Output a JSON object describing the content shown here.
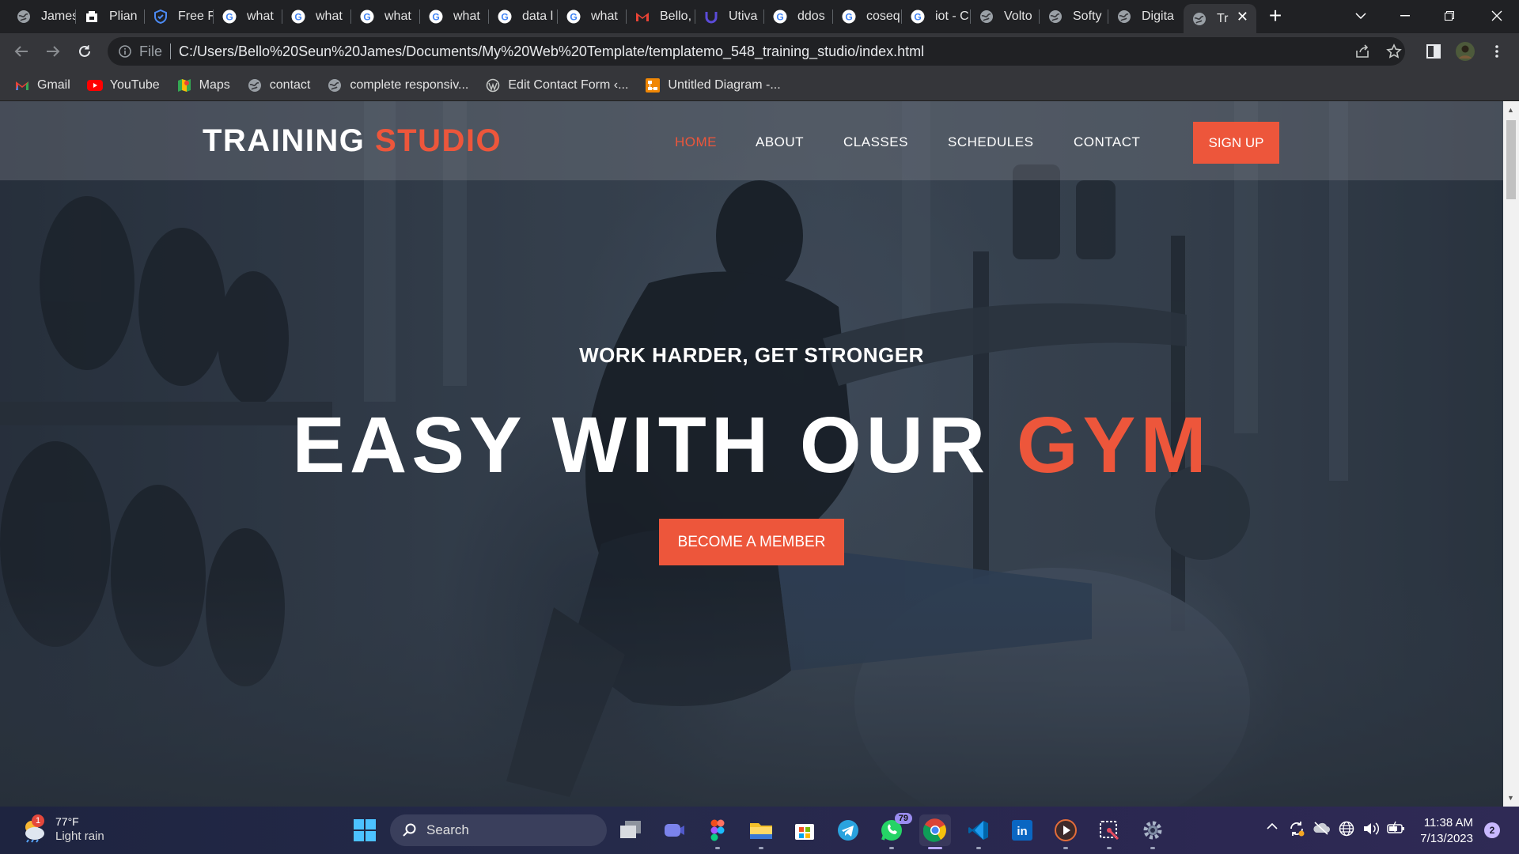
{
  "browser": {
    "tabs": [
      {
        "title": "James",
        "icon": "globe-icon"
      },
      {
        "title": "Plian",
        "icon": "plian-icon"
      },
      {
        "title": "Free F",
        "icon": "shield-icon"
      },
      {
        "title": "what",
        "icon": "google-icon"
      },
      {
        "title": "what",
        "icon": "google-icon"
      },
      {
        "title": "what",
        "icon": "google-icon"
      },
      {
        "title": "what",
        "icon": "google-icon"
      },
      {
        "title": "data l",
        "icon": "google-icon"
      },
      {
        "title": "what",
        "icon": "google-icon"
      },
      {
        "title": "Bello,",
        "icon": "gmail-icon"
      },
      {
        "title": "Utiva",
        "icon": "utiva-icon"
      },
      {
        "title": "ddos",
        "icon": "google-icon"
      },
      {
        "title": "coseq",
        "icon": "google-icon"
      },
      {
        "title": "iot - C",
        "icon": "google-icon"
      },
      {
        "title": "Volto",
        "icon": "globe-icon"
      },
      {
        "title": "Softy",
        "icon": "globe-icon"
      },
      {
        "title": "Digita",
        "icon": "globe-icon"
      },
      {
        "title": "Tr",
        "icon": "globe-icon",
        "active": true
      }
    ],
    "address": {
      "scheme_label": "File",
      "url": "C:/Users/Bello%20Seun%20James/Documents/My%20Web%20Template/templatemo_548_training_studio/index.html"
    },
    "bookmarks": [
      {
        "label": "Gmail",
        "icon": "gmail-icon"
      },
      {
        "label": "YouTube",
        "icon": "youtube-icon"
      },
      {
        "label": "Maps",
        "icon": "maps-icon"
      },
      {
        "label": "contact",
        "icon": "globe-icon"
      },
      {
        "label": "complete responsiv...",
        "icon": "globe-icon"
      },
      {
        "label": "Edit Contact Form ‹...",
        "icon": "wordpress-icon"
      },
      {
        "label": "Untitled Diagram -...",
        "icon": "drawio-icon"
      }
    ]
  },
  "site": {
    "logo_main": "TRAINING",
    "logo_accent": "STUDIO",
    "nav": {
      "home": "HOME",
      "about": "ABOUT",
      "classes": "CLASSES",
      "schedules": "SCHEDULES",
      "contact": "CONTACT"
    },
    "signup_label": "SIGN UP",
    "hero": {
      "tagline": "WORK HARDER, GET STRONGER",
      "headline_main": "EASY WITH OUR",
      "headline_accent": "GYM",
      "cta_label": "BECOME A MEMBER"
    },
    "colors": {
      "accent": "#ed563b"
    }
  },
  "taskbar": {
    "weather": {
      "temp": "77°F",
      "condition": "Light rain",
      "alert_count": "1"
    },
    "search_label": "Search",
    "apps": [
      {
        "name": "start-button"
      },
      {
        "name": "task-view"
      },
      {
        "name": "teams"
      },
      {
        "name": "figma"
      },
      {
        "name": "file-explorer"
      },
      {
        "name": "microsoft-store"
      },
      {
        "name": "telegram"
      },
      {
        "name": "whatsapp",
        "badge": "79"
      },
      {
        "name": "chrome"
      },
      {
        "name": "vscode"
      },
      {
        "name": "linkedin"
      },
      {
        "name": "media-player"
      },
      {
        "name": "snipping-tool"
      },
      {
        "name": "settings"
      }
    ],
    "clock": {
      "time": "11:38 AM",
      "date": "7/13/2023"
    },
    "notification_count": "2"
  }
}
